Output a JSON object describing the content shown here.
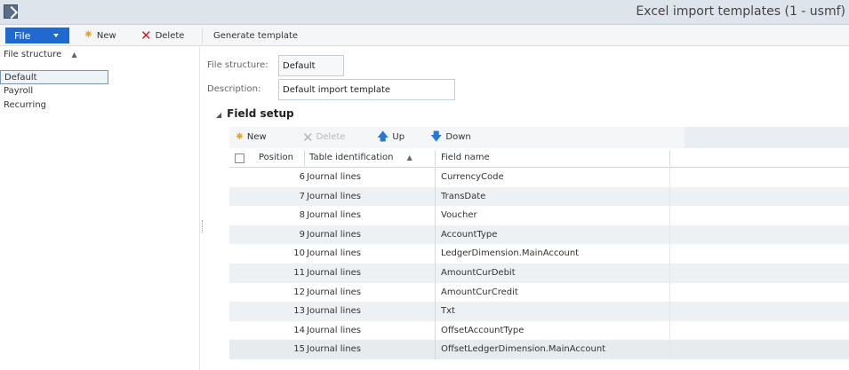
{
  "window": {
    "title": "Excel import templates (1 - usmf)"
  },
  "toolbar": {
    "file_label": "File",
    "new_label": "New",
    "delete_label": "Delete",
    "generate_label": "Generate template"
  },
  "left_panel": {
    "header": "File structure",
    "sort_indicator": "▲",
    "items": [
      {
        "label": "Default",
        "selected": true
      },
      {
        "label": "Payroll",
        "selected": false
      },
      {
        "label": "Recurring",
        "selected": false
      }
    ]
  },
  "details": {
    "file_structure_label": "File structure:",
    "file_structure_value": "Default",
    "description_label": "Description:",
    "description_value": "Default import template"
  },
  "field_setup": {
    "title": "Field setup",
    "caret": "◢",
    "toolbar": {
      "new_label": "New",
      "delete_label": "Delete",
      "up_label": "Up",
      "down_label": "Down"
    },
    "columns": {
      "position": "Position",
      "table": "Table identification",
      "table_sort": "▲",
      "field": "Field name"
    },
    "rows": [
      {
        "position": "6",
        "table": "Journal lines",
        "field": "CurrencyCode"
      },
      {
        "position": "7",
        "table": "Journal lines",
        "field": "TransDate"
      },
      {
        "position": "8",
        "table": "Journal lines",
        "field": "Voucher"
      },
      {
        "position": "9",
        "table": "Journal lines",
        "field": "AccountType"
      },
      {
        "position": "10",
        "table": "Journal lines",
        "field": "LedgerDimension.MainAccount"
      },
      {
        "position": "11",
        "table": "Journal lines",
        "field": "AmountCurDebit"
      },
      {
        "position": "12",
        "table": "Journal lines",
        "field": "AmountCurCredit"
      },
      {
        "position": "13",
        "table": "Journal lines",
        "field": "Txt"
      },
      {
        "position": "14",
        "table": "Journal lines",
        "field": "OffsetAccountType"
      },
      {
        "position": "15",
        "table": "Journal lines",
        "field": "OffsetLedgerDimension.MainAccount"
      }
    ]
  },
  "colors": {
    "accent": "#1e6ad0",
    "new_icon": "#e8a317",
    "delete_icon": "#c62828",
    "arrow_icon": "#2b78d1"
  }
}
